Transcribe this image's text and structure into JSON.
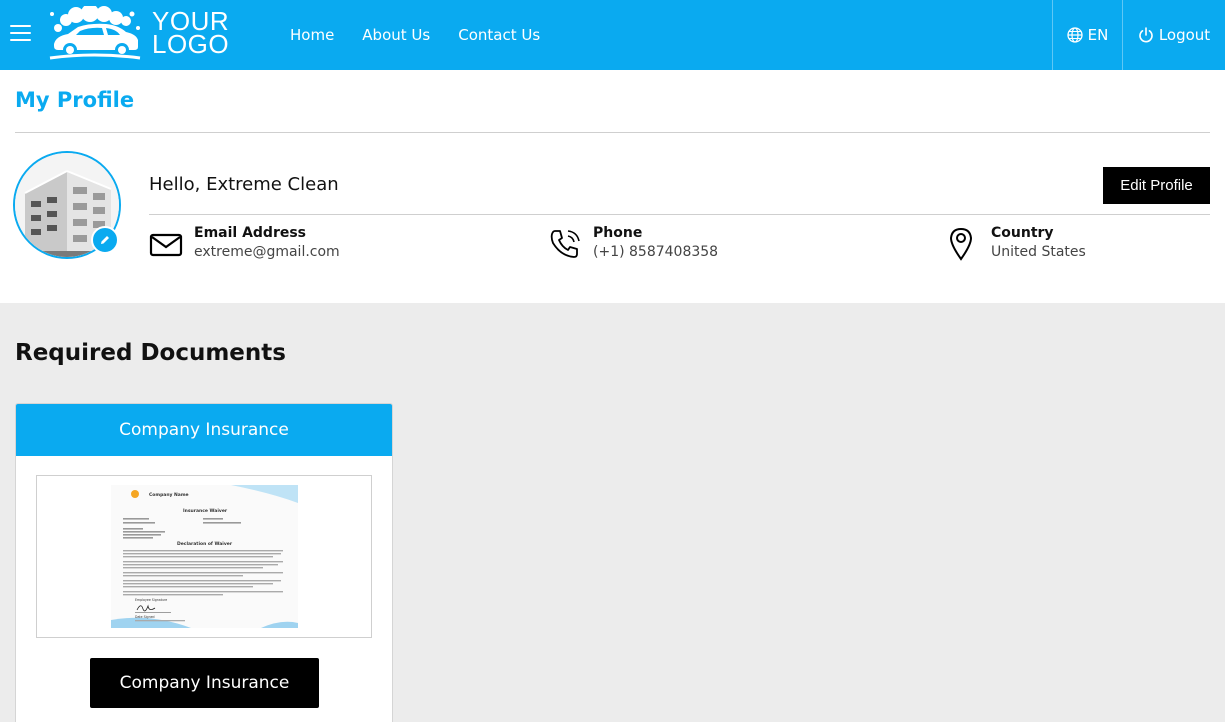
{
  "header": {
    "logo_line1": "YOUR",
    "logo_line2": "LOGO",
    "nav": [
      {
        "label": "Home"
      },
      {
        "label": "About Us"
      },
      {
        "label": "Contact Us"
      }
    ],
    "language": "EN",
    "logout": "Logout"
  },
  "profile": {
    "page_title": "My Profile",
    "greeting": "Hello, Extreme Clean",
    "edit_button": "Edit Profile",
    "email": {
      "label": "Email Address",
      "value": "extreme@gmail.com"
    },
    "phone": {
      "label": "Phone",
      "value": "(+1) 8587408358"
    },
    "country": {
      "label": "Country",
      "value": "United States"
    }
  },
  "documents": {
    "section_title": "Required Documents",
    "cards": [
      {
        "header": "Company Insurance",
        "button": "Company Insurance",
        "preview": {
          "company_name": "Company Name",
          "doc_title": "Insurance Waiver",
          "section_heading": "Declaration of Waiver",
          "signature_label": "Employee Signature",
          "date_label": "Date Signed"
        }
      }
    ]
  },
  "colors": {
    "brand": "#0aaaf0",
    "page_bg": "#ececec",
    "button_dark": "#000000"
  },
  "icons": [
    "menu-icon",
    "car-wash-logo-icon",
    "globe-icon",
    "power-icon",
    "pencil-icon",
    "envelope-icon",
    "phone-icon",
    "map-pin-icon"
  ]
}
